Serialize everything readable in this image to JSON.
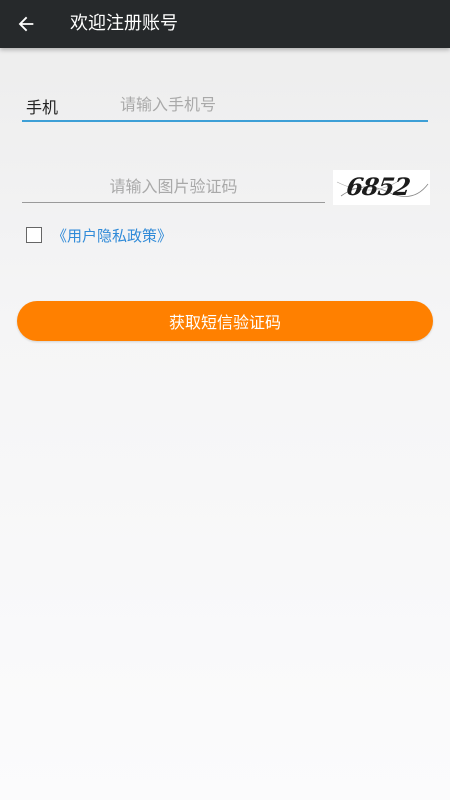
{
  "header": {
    "title": "欢迎注册账号",
    "back_icon": "arrow-left-icon"
  },
  "form": {
    "phone_label": "手机",
    "phone_placeholder": "请输入手机号",
    "phone_value": "",
    "captcha_placeholder": "请输入图片验证码",
    "captcha_value": "",
    "captcha_image_text": "6852",
    "privacy_checked": false,
    "privacy_link": "《用户隐私政策》",
    "submit_label": "获取短信验证码"
  },
  "colors": {
    "appbar": "#26292b",
    "accent_underline": "#3d9fd6",
    "link": "#2f8ad8",
    "button": "#ff8000"
  }
}
